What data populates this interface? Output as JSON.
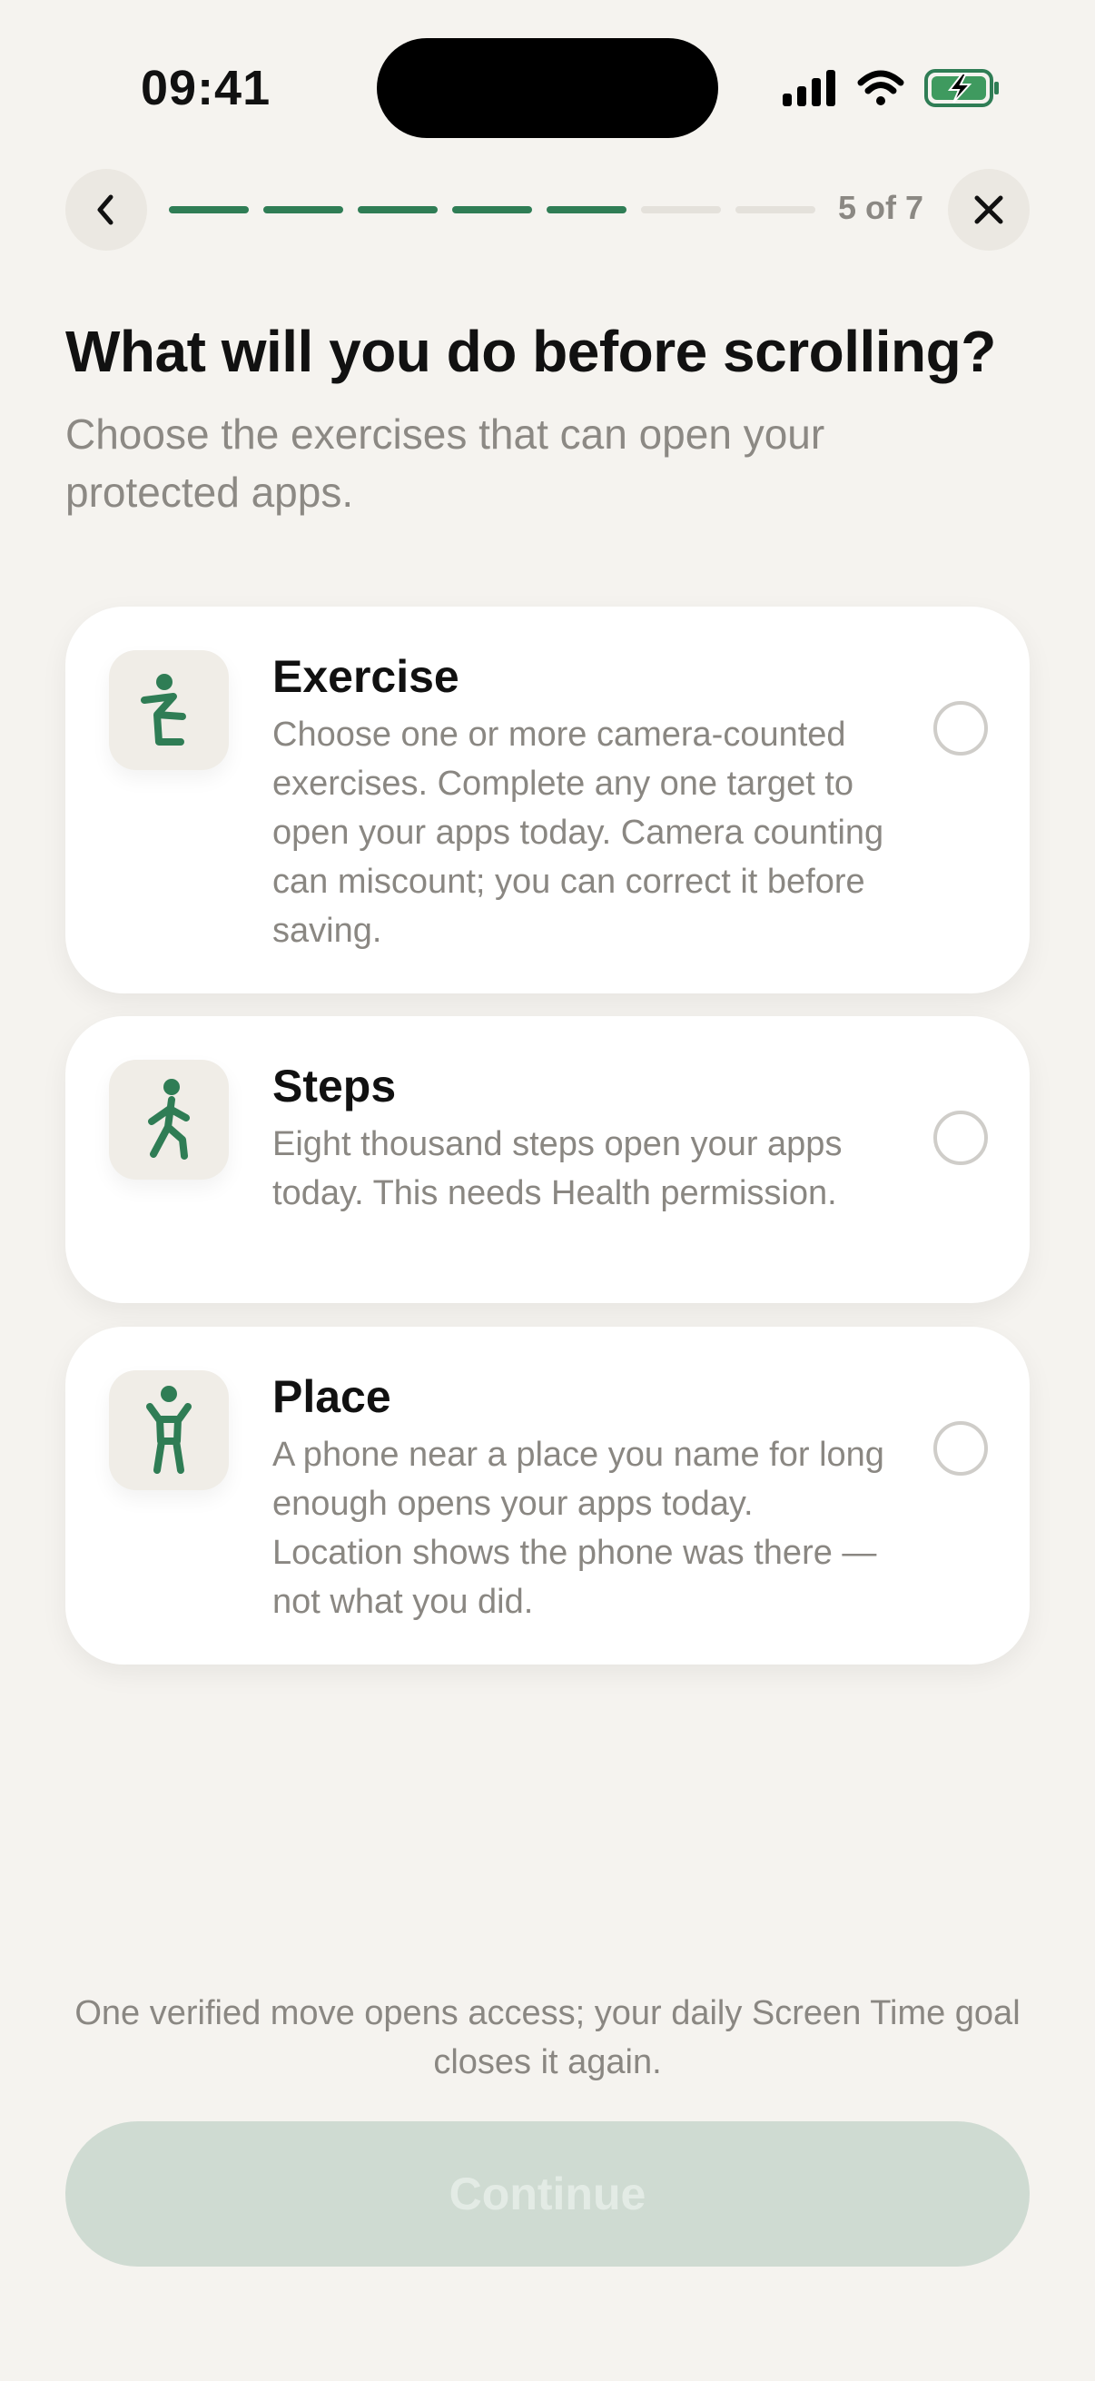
{
  "status_bar": {
    "time": "09:41"
  },
  "nav": {
    "progress_total": 7,
    "progress_current": 5,
    "step_label": "5 of 7"
  },
  "header": {
    "title": "What will you do before scrolling?",
    "subtitle": "Choose the exercises that can open your protected apps."
  },
  "options": [
    {
      "title": "Exercise",
      "description": "Choose one or more camera-counted exercises. Complete any one target to open your apps today. Camera counting can miscount; you can correct it before saving.",
      "icon": "squat-figure-icon",
      "selected": false
    },
    {
      "title": "Steps",
      "description": "Eight thousand steps open your apps today. This needs Health permission.",
      "icon": "walking-figure-icon",
      "selected": false
    },
    {
      "title": "Place",
      "description": "A phone near a place you name for long enough opens your apps today. Location shows the phone was there — not what you did.",
      "icon": "standing-figure-icon",
      "selected": false
    }
  ],
  "footer": {
    "note": "One verified move opens access; your daily Screen Time goal closes it again.",
    "continue_label": "Continue"
  },
  "colors": {
    "accent": "#2f7d55",
    "background": "#f5f3ef",
    "card": "#ffffff",
    "button_disabled": "#cfdbd2"
  }
}
